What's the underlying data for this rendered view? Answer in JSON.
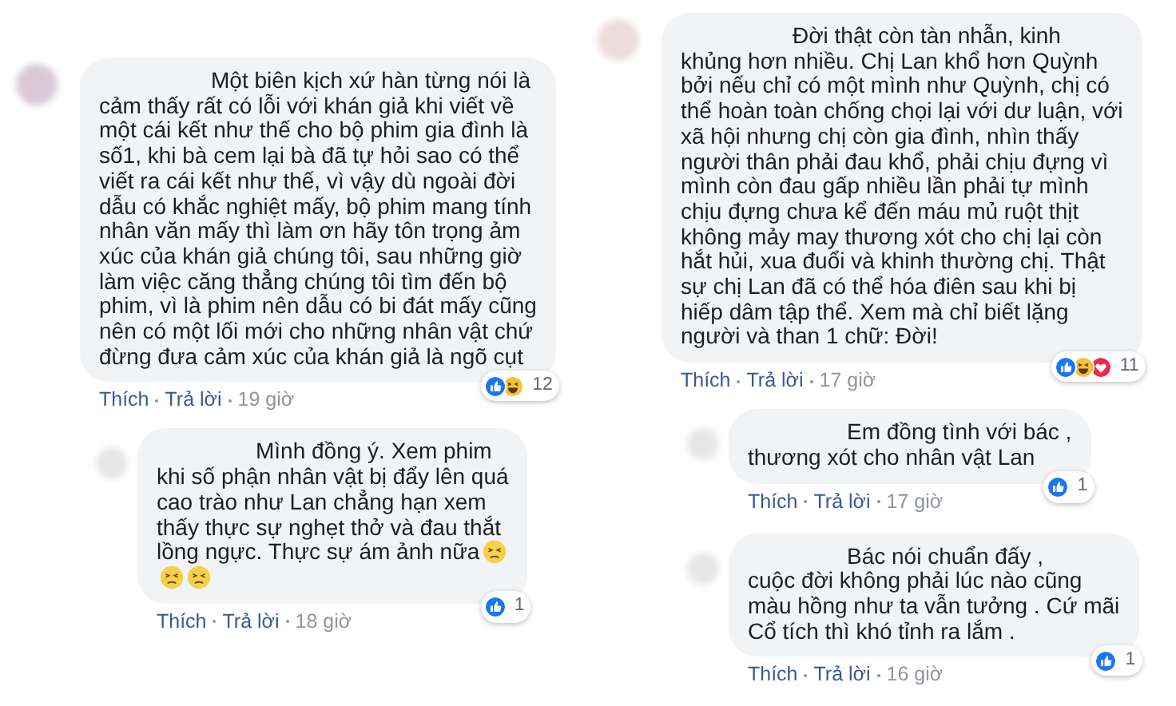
{
  "columns": [
    {
      "comments": [
        {
          "text": "Một biên kịch xứ hàn từng nói là\ncảm thấy rất có lỗi với khán giả khi viết về\nmột cái kết như thế cho bộ phim gia đình là\nsố1, khi bà cem lại bà đã tự hỏi sao có thể\nviết ra cái kết như thế, vì vậy dù ngoài đời\ndẫu có khắc nghiệt mấy, bộ phim mang tính\nnhân văn mấy thì làm ơn hãy tôn trọng ảm\nxúc của khán giả chúng tôi, sau những giờ\nlàm việc căng thẳng chúng tôi tìm đến bộ\nphim, vì là phim nên dẫu có bi đát mấy cũng\nnên có một lối mới cho những nhân vật chứ\nđừng đưa cảm xúc của khán giả là ngõ cụt",
          "reactions": [
            {
              "kind": "like"
            },
            {
              "kind": "haha"
            }
          ],
          "reaction_count": "12",
          "like": "Thích",
          "reply": "Trả lời",
          "time": "19 giờ",
          "replies": [
            {
              "text": "Mình đồng ý. Xem phim\nkhi số phận nhân vật bị đẩy lên quá\ncao trào như Lan chẳng hạn xem\nthấy thực sự nghẹt thở và đau thắt\nlồng ngực. Thực sự ám ảnh nữa",
              "emoji": [
                {
                  "kind": "persevering"
                },
                {
                  "kind": "persevering"
                },
                {
                  "kind": "persevering"
                }
              ],
              "reactions": [
                {
                  "kind": "like"
                }
              ],
              "reaction_count": "1",
              "like": "Thích",
              "reply": "Trả lời",
              "time": "18 giờ"
            }
          ]
        }
      ]
    },
    {
      "comments": [
        {
          "text": "Đời thật còn tàn nhẫn, kinh\nkhủng hơn nhiều. Chị Lan khổ hơn Quỳnh\nbởi nếu chỉ có một mình như Quỳnh, chị có\nthể hoàn toàn chống chọi lại với dư luận, với\nxã hội nhưng chị còn gia đình, nhìn thấy\nngười thân phải đau khổ, phải chịu đựng vì\nmình còn đau gấp nhiều lần phải tự mình\nchịu đựng chưa kể đến máu mủ ruột thịt\nkhông mảy may thương xót cho chị lại còn\nhắt hủi, xua đuổi và khinh thường chị. Thật\nsự chị Lan đã có thể hóa điên sau khi bị\nhiếp dâm tập thể. Xem mà chỉ biết lặng\nngười và than 1 chữ: Đời!",
          "reactions": [
            {
              "kind": "like"
            },
            {
              "kind": "haha"
            },
            {
              "kind": "love"
            }
          ],
          "reaction_count": "11",
          "like": "Thích",
          "reply": "Trả lời",
          "time": "17 giờ",
          "replies": [
            {
              "text": "Em đồng tình với bác ,\nthương xót cho nhân vật Lan",
              "reactions": [
                {
                  "kind": "like"
                }
              ],
              "reaction_count": "1",
              "like": "Thích",
              "reply": "Trả lời",
              "time": "17 giờ"
            },
            {
              "text": "Bác nói chuẩn đấy ,\ncuộc đời không phải lúc nào cũng\nmàu hồng như ta vẫn tưởng . Cứ mãi\nCổ tích thì khó tỉnh ra lắm .",
              "reactions": [
                {
                  "kind": "like"
                }
              ],
              "reaction_count": "1",
              "like": "Thích",
              "reply": "Trả lời",
              "time": "16 giờ"
            }
          ]
        }
      ]
    }
  ]
}
